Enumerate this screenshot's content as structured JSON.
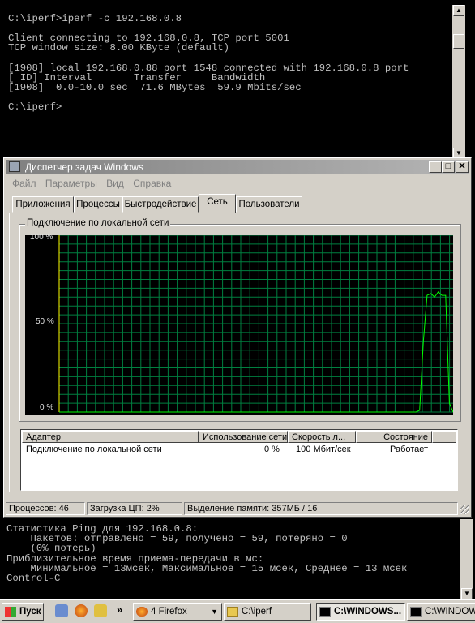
{
  "cmd_top": {
    "lines": [
      "C:\\iperf>iperf -c 192.168.0.8",
      "---",
      "Client connecting to 192.168.0.8, TCP port 5001",
      "TCP window size: 8.00 KByte (default)",
      "---",
      "[1908] local 192.168.0.88 port 1548 connected with 192.168.0.8 port",
      "[ ID] Interval       Transfer     Bandwidth",
      "[1908]  0.0-10.0 sec  71.6 MBytes  59.9 Mbits/sec",
      "",
      "C:\\iperf>"
    ]
  },
  "taskmgr": {
    "title": "Диспетчер задач Windows",
    "menu": [
      "Файл",
      "Параметры",
      "Вид",
      "Справка"
    ],
    "tabs": [
      "Приложения",
      "Процессы",
      "Быстродействие",
      "Сеть",
      "Пользователи"
    ],
    "active_tab": 3,
    "group_label": "Подключение по локальной сети",
    "y_labels": [
      "100 %",
      "50 %",
      "0 %"
    ],
    "graph_colors": {
      "background": "#000000",
      "grid": "#008040",
      "line": "#00ff00",
      "line2": "#ffff00"
    },
    "chart_data": {
      "type": "line",
      "title": "Подключение по локальной сети",
      "ylim": [
        0,
        100
      ],
      "y_ticks": [
        "100 %",
        "50 %",
        "0 %"
      ],
      "grid": true,
      "series": [
        {
          "values": [
            0,
            0,
            0,
            0,
            0,
            0,
            0,
            0,
            0,
            0,
            0,
            0,
            0,
            0,
            0,
            0,
            0,
            0,
            0,
            0,
            0,
            0,
            0,
            0,
            0,
            0,
            0,
            0,
            0,
            0,
            0,
            0,
            0,
            0,
            0,
            0,
            0,
            0,
            0,
            0,
            0,
            0,
            0,
            0,
            0,
            0,
            0,
            0,
            0,
            0,
            0,
            0,
            0,
            0,
            0,
            0,
            0,
            0,
            0,
            0,
            0,
            0,
            0,
            0,
            0,
            0,
            0,
            0,
            0,
            0,
            0,
            0,
            0,
            0,
            0,
            0,
            0,
            0,
            0,
            0,
            0,
            0,
            0,
            0,
            0,
            0,
            0,
            0,
            0,
            0,
            0,
            0,
            0,
            0,
            0,
            0,
            0,
            1,
            40,
            66,
            67,
            65,
            68,
            66,
            66,
            5,
            0
          ]
        }
      ]
    },
    "table": {
      "headers": [
        "Адаптер",
        "Использование сети",
        "Скорость л...",
        "Состояние"
      ],
      "rows": [
        [
          "Подключение по локальной сети",
          "0 %",
          "100 Мбит/сек",
          "Работает"
        ]
      ]
    },
    "status": {
      "processes": "Процессов: 46",
      "cpu": "Загрузка ЦП: 2%",
      "memory": "Выделение памяти: 357МБ / 16"
    }
  },
  "cmd_bottom": {
    "lines": [
      "Статистика Ping для 192.168.0.8:",
      "    Пакетов: отправлено = 59, получено = 59, потеряно = 0",
      "    (0% потерь)",
      "Приблизительное время приема-передачи в мс:",
      "    Минимальное = 13мсек, Максимальное = 15 мсек, Среднее = 13 мсек",
      "Control-C"
    ]
  },
  "taskbar": {
    "start": "Пуск",
    "chevron": "»",
    "buttons": [
      "4 Firefox",
      "C:\\iperf",
      "C:\\WINDOWS...",
      "C:\\WINDOW"
    ]
  }
}
